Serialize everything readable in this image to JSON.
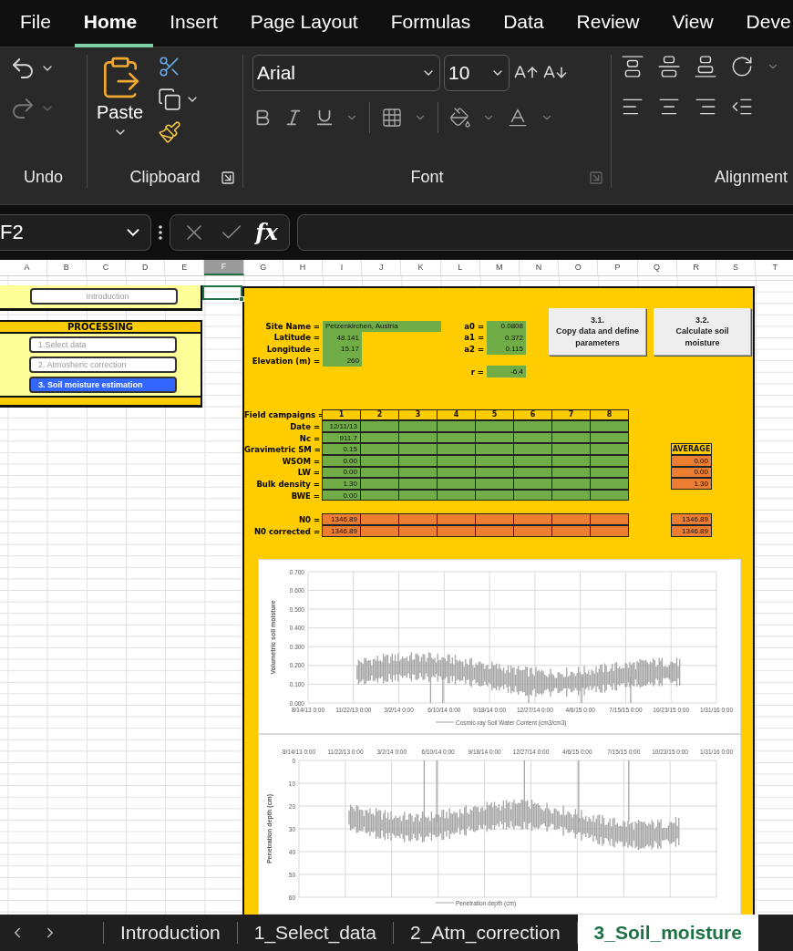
{
  "ribbon_tabs": [
    {
      "label": "File",
      "selected": false
    },
    {
      "label": "Home",
      "selected": true
    },
    {
      "label": "Insert",
      "selected": false
    },
    {
      "label": "Page Layout",
      "selected": false
    },
    {
      "label": "Formulas",
      "selected": false
    },
    {
      "label": "Data",
      "selected": false
    },
    {
      "label": "Review",
      "selected": false
    },
    {
      "label": "View",
      "selected": false
    },
    {
      "label": "Deve",
      "selected": false
    }
  ],
  "ribbon": {
    "undo": {
      "label": "Undo"
    },
    "clipboard": {
      "label": "Clipboard",
      "paste": "Paste"
    },
    "font": {
      "label": "Font",
      "font_name": "Arial",
      "font_size": "10"
    },
    "alignment": {
      "label": "Alignment"
    }
  },
  "formula_bar": {
    "name_box": "F2",
    "function_label": "fx"
  },
  "column_headers": [
    {
      "label": "A",
      "selected": false
    },
    {
      "label": "B",
      "selected": false
    },
    {
      "label": "C",
      "selected": false
    },
    {
      "label": "D",
      "selected": false
    },
    {
      "label": "E",
      "selected": false
    },
    {
      "label": "F",
      "selected": true
    },
    {
      "label": "G",
      "selected": false
    },
    {
      "label": "H",
      "selected": false
    },
    {
      "label": "I",
      "selected": false
    },
    {
      "label": "J",
      "selected": false
    },
    {
      "label": "K",
      "selected": false
    },
    {
      "label": "L",
      "selected": false
    },
    {
      "label": "M",
      "selected": false
    },
    {
      "label": "N",
      "selected": false
    },
    {
      "label": "O",
      "selected": false
    },
    {
      "label": "P",
      "selected": false
    },
    {
      "label": "Q",
      "selected": false
    },
    {
      "label": "R",
      "selected": false
    },
    {
      "label": "S",
      "selected": false
    },
    {
      "label": "T",
      "selected": false
    }
  ],
  "navigation": {
    "intro_button": "Introduction",
    "processing_title": "PROCESSING",
    "steps": [
      {
        "label": "1.Select data",
        "selected": false
      },
      {
        "label": "2. Atmosheric correction",
        "selected": false
      },
      {
        "label": "3.  Soil moisture estimation",
        "selected": true
      }
    ]
  },
  "site": [
    {
      "label": "Site Name =",
      "value": "Petzenkirchen, Austria"
    },
    {
      "label": "Latitude =",
      "value": "48.141"
    },
    {
      "label": "Longitude =",
      "value": "15.17"
    },
    {
      "label": "Elevation (m) =",
      "value": "260"
    }
  ],
  "coefficients": [
    {
      "label": "a0 =",
      "value": "0.0808"
    },
    {
      "label": "a1 =",
      "value": "0.372"
    },
    {
      "label": "a2 =",
      "value": "0.115"
    }
  ],
  "r": {
    "label": "r =",
    "value": "-6.4"
  },
  "action_buttons": [
    {
      "number": "3.1.",
      "label": "Copy data and define parameters"
    },
    {
      "number": "3.2.",
      "label": "Calculate soil moisture"
    }
  ],
  "campaigns": {
    "label": "Field campaigns =",
    "columns": [
      "1",
      "2",
      "3",
      "4",
      "5",
      "6",
      "7",
      "8"
    ],
    "rows": [
      {
        "label": "Date =",
        "first": "12/11/13"
      },
      {
        "label": "Nc =",
        "first": "911.7"
      },
      {
        "label": "Gravimetric SM =",
        "first": "0.15",
        "average": {
          "kind": "header",
          "text": "AVERAGE"
        }
      },
      {
        "label": "WSOM =",
        "first": "0.00",
        "average": {
          "kind": "value",
          "text": "0.00"
        }
      },
      {
        "label": "LW =",
        "first": "0.00",
        "average": {
          "kind": "value",
          "text": "0.00"
        }
      },
      {
        "label": "Bulk density =",
        "first": "1.30",
        "average": {
          "kind": "value",
          "text": "1.30"
        }
      },
      {
        "label": "BWE =",
        "first": "0.00"
      }
    ],
    "results": [
      {
        "label": "N0 =",
        "first": "1346.89",
        "average": {
          "kind": "value",
          "text": "1346.89"
        }
      },
      {
        "label": "N0 corrected  =",
        "first": "1346.89",
        "average": {
          "kind": "value",
          "text": "1346.89"
        }
      }
    ]
  },
  "charts": [
    {
      "kind": "bottom_axis",
      "ylabel": "Volumetric soil moisture",
      "yticks": [
        "0.700",
        "0.600",
        "0.500",
        "0.400",
        "0.300",
        "0.200",
        "0.100",
        "0.000"
      ],
      "xticks": [
        "8/14/13 0:00",
        "11/22/13 0:00",
        "3/2/14 0:00",
        "6/10/14 0:00",
        "9/18/14 0:00",
        "12/27/14 0:00",
        "4/6/15 0:00",
        "7/15/15 0:00",
        "10/23/15 0:00",
        "1/31/16 0:00"
      ],
      "legend": "Cosmic-ray Soil Water Content (cm3/cm3)"
    },
    {
      "kind": "top_axis",
      "ylabel": "Penetration depth (cm)",
      "yticks": [
        "0",
        "10",
        "20",
        "30",
        "40",
        "50",
        "60"
      ],
      "xticks": [
        "8/14/13 0:00",
        "11/22/13 0:00",
        "3/2/14 0:00",
        "6/10/14 0:00",
        "9/18/14 0:00",
        "12/27/14 0:00",
        "4/6/15 0:00",
        "7/15/15 0:00",
        "10/23/15 0:00",
        "1/31/16 0:00"
      ],
      "legend": "Penetration depth (cm)"
    }
  ],
  "sheet_tabs": [
    {
      "label": "Introduction",
      "selected": false
    },
    {
      "label": "1_Select_data",
      "selected": false
    },
    {
      "label": "2_Atm_correction",
      "selected": false
    },
    {
      "label": "3_Soil_moisture",
      "selected": true
    }
  ]
}
